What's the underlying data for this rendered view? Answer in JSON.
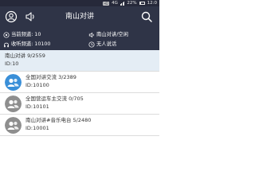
{
  "status_bar": {
    "hd_badge": "HD",
    "network": "4G",
    "battery_percent": 22,
    "battery_text": "22%",
    "time": "12:0"
  },
  "header": {
    "title": "南山对讲",
    "left_icon": "person-circle-icon",
    "volume_icon": "speaker-icon",
    "search_icon": "search-icon"
  },
  "info": {
    "current_channel": "当前频道: 10",
    "channel_status": "南山对讲/空闲",
    "listening_channel": "收听频道: 10100",
    "speaker_status": "无人说话"
  },
  "colors": {
    "header_bg": "#2f3447",
    "status_bg": "#26293a",
    "selected_row_bg": "#e4edf5",
    "avatar_active": "#3a8fd8",
    "avatar_inactive": "#8e8e8e"
  },
  "channels": [
    {
      "name": "南山对讲 9/2559",
      "id": "ID:10",
      "selected": true,
      "avatar": "none"
    },
    {
      "name": "全国对讲交流 3/2389",
      "id": "ID:10100",
      "selected": false,
      "avatar": "blue-group-icon"
    },
    {
      "name": "全国营运车主交流 0/705",
      "id": "ID:10101",
      "selected": false,
      "avatar": "gray-group-icon"
    },
    {
      "name": "南山对讲#音乐电台 5/2480",
      "id": "ID:10001",
      "selected": false,
      "avatar": "gray-group-icon"
    }
  ]
}
